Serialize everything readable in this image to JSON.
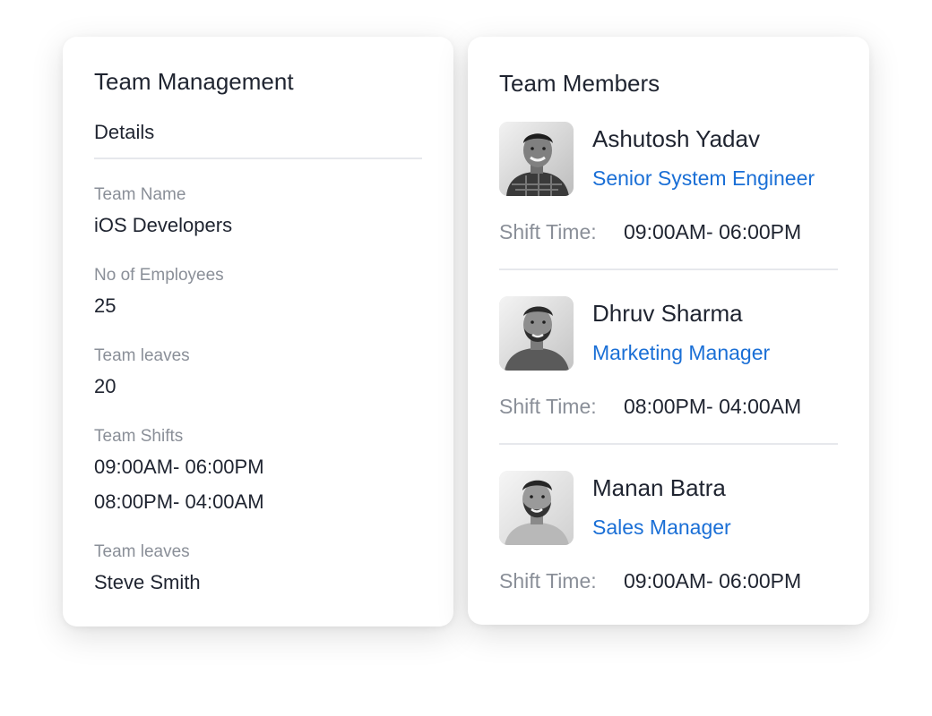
{
  "team_management": {
    "title": "Team Management",
    "section_title": "Details",
    "fields": [
      {
        "label": "Team Name",
        "value": "iOS Developers"
      },
      {
        "label": "No of Employees",
        "value": "25"
      },
      {
        "label": "Team leaves",
        "value": "20"
      },
      {
        "label": "Team Shifts",
        "values": [
          "09:00AM- 06:00PM",
          "08:00PM- 04:00AM"
        ]
      },
      {
        "label": "Team leaves",
        "value": "Steve Smith"
      }
    ]
  },
  "team_members": {
    "title": "Team Members",
    "shift_label": "Shift Time:",
    "members": [
      {
        "name": "Ashutosh Yadav",
        "role": "Senior System Engineer",
        "shift": "09:00AM- 06:00PM"
      },
      {
        "name": "Dhruv Sharma",
        "role": "Marketing Manager",
        "shift": "08:00PM- 04:00AM"
      },
      {
        "name": "Manan Batra",
        "role": "Sales Manager",
        "shift": "09:00AM- 06:00PM"
      }
    ]
  },
  "colors": {
    "accent": "#1a6fd6",
    "text": "#1f2430",
    "muted": "#8a8f98",
    "divider": "#e6e8ec"
  }
}
